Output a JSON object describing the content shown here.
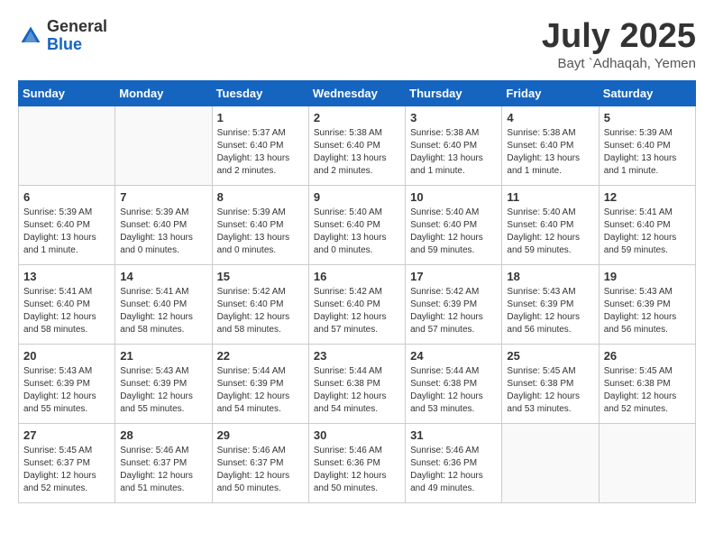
{
  "logo": {
    "general": "General",
    "blue": "Blue"
  },
  "title": "July 2025",
  "subtitle": "Bayt `Adhaqah, Yemen",
  "days_of_week": [
    "Sunday",
    "Monday",
    "Tuesday",
    "Wednesday",
    "Thursday",
    "Friday",
    "Saturday"
  ],
  "weeks": [
    [
      {
        "day": "",
        "info": ""
      },
      {
        "day": "",
        "info": ""
      },
      {
        "day": "1",
        "info": "Sunrise: 5:37 AM\nSunset: 6:40 PM\nDaylight: 13 hours and 2 minutes."
      },
      {
        "day": "2",
        "info": "Sunrise: 5:38 AM\nSunset: 6:40 PM\nDaylight: 13 hours and 2 minutes."
      },
      {
        "day": "3",
        "info": "Sunrise: 5:38 AM\nSunset: 6:40 PM\nDaylight: 13 hours and 1 minute."
      },
      {
        "day": "4",
        "info": "Sunrise: 5:38 AM\nSunset: 6:40 PM\nDaylight: 13 hours and 1 minute."
      },
      {
        "day": "5",
        "info": "Sunrise: 5:39 AM\nSunset: 6:40 PM\nDaylight: 13 hours and 1 minute."
      }
    ],
    [
      {
        "day": "6",
        "info": "Sunrise: 5:39 AM\nSunset: 6:40 PM\nDaylight: 13 hours and 1 minute."
      },
      {
        "day": "7",
        "info": "Sunrise: 5:39 AM\nSunset: 6:40 PM\nDaylight: 13 hours and 0 minutes."
      },
      {
        "day": "8",
        "info": "Sunrise: 5:39 AM\nSunset: 6:40 PM\nDaylight: 13 hours and 0 minutes."
      },
      {
        "day": "9",
        "info": "Sunrise: 5:40 AM\nSunset: 6:40 PM\nDaylight: 13 hours and 0 minutes."
      },
      {
        "day": "10",
        "info": "Sunrise: 5:40 AM\nSunset: 6:40 PM\nDaylight: 12 hours and 59 minutes."
      },
      {
        "day": "11",
        "info": "Sunrise: 5:40 AM\nSunset: 6:40 PM\nDaylight: 12 hours and 59 minutes."
      },
      {
        "day": "12",
        "info": "Sunrise: 5:41 AM\nSunset: 6:40 PM\nDaylight: 12 hours and 59 minutes."
      }
    ],
    [
      {
        "day": "13",
        "info": "Sunrise: 5:41 AM\nSunset: 6:40 PM\nDaylight: 12 hours and 58 minutes."
      },
      {
        "day": "14",
        "info": "Sunrise: 5:41 AM\nSunset: 6:40 PM\nDaylight: 12 hours and 58 minutes."
      },
      {
        "day": "15",
        "info": "Sunrise: 5:42 AM\nSunset: 6:40 PM\nDaylight: 12 hours and 58 minutes."
      },
      {
        "day": "16",
        "info": "Sunrise: 5:42 AM\nSunset: 6:40 PM\nDaylight: 12 hours and 57 minutes."
      },
      {
        "day": "17",
        "info": "Sunrise: 5:42 AM\nSunset: 6:39 PM\nDaylight: 12 hours and 57 minutes."
      },
      {
        "day": "18",
        "info": "Sunrise: 5:43 AM\nSunset: 6:39 PM\nDaylight: 12 hours and 56 minutes."
      },
      {
        "day": "19",
        "info": "Sunrise: 5:43 AM\nSunset: 6:39 PM\nDaylight: 12 hours and 56 minutes."
      }
    ],
    [
      {
        "day": "20",
        "info": "Sunrise: 5:43 AM\nSunset: 6:39 PM\nDaylight: 12 hours and 55 minutes."
      },
      {
        "day": "21",
        "info": "Sunrise: 5:43 AM\nSunset: 6:39 PM\nDaylight: 12 hours and 55 minutes."
      },
      {
        "day": "22",
        "info": "Sunrise: 5:44 AM\nSunset: 6:39 PM\nDaylight: 12 hours and 54 minutes."
      },
      {
        "day": "23",
        "info": "Sunrise: 5:44 AM\nSunset: 6:38 PM\nDaylight: 12 hours and 54 minutes."
      },
      {
        "day": "24",
        "info": "Sunrise: 5:44 AM\nSunset: 6:38 PM\nDaylight: 12 hours and 53 minutes."
      },
      {
        "day": "25",
        "info": "Sunrise: 5:45 AM\nSunset: 6:38 PM\nDaylight: 12 hours and 53 minutes."
      },
      {
        "day": "26",
        "info": "Sunrise: 5:45 AM\nSunset: 6:38 PM\nDaylight: 12 hours and 52 minutes."
      }
    ],
    [
      {
        "day": "27",
        "info": "Sunrise: 5:45 AM\nSunset: 6:37 PM\nDaylight: 12 hours and 52 minutes."
      },
      {
        "day": "28",
        "info": "Sunrise: 5:46 AM\nSunset: 6:37 PM\nDaylight: 12 hours and 51 minutes."
      },
      {
        "day": "29",
        "info": "Sunrise: 5:46 AM\nSunset: 6:37 PM\nDaylight: 12 hours and 50 minutes."
      },
      {
        "day": "30",
        "info": "Sunrise: 5:46 AM\nSunset: 6:36 PM\nDaylight: 12 hours and 50 minutes."
      },
      {
        "day": "31",
        "info": "Sunrise: 5:46 AM\nSunset: 6:36 PM\nDaylight: 12 hours and 49 minutes."
      },
      {
        "day": "",
        "info": ""
      },
      {
        "day": "",
        "info": ""
      }
    ]
  ]
}
